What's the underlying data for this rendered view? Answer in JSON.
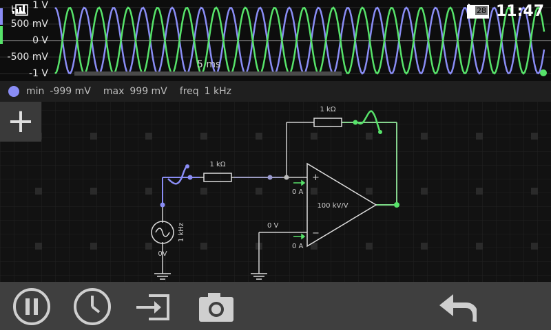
{
  "status_bar": {
    "time": "11:47",
    "battery": "28",
    "carrier": "H"
  },
  "scope": {
    "y_labels": [
      "1 V",
      "500 mV",
      "0 V",
      "-500 mV",
      "-1 V"
    ],
    "timebase": "5 ms",
    "colors": {
      "trace1": "#8a8df5",
      "trace2": "#57e36a"
    }
  },
  "info": {
    "min_label": "min",
    "min_value": "-999 mV",
    "max_label": "max",
    "max_value": "999 mV",
    "freq_label": "freq",
    "freq_value": "1 kHz"
  },
  "circuit": {
    "r_in": "1 kΩ",
    "r_fb": "1 kΩ",
    "source_freq": "1 kHz",
    "source_ground": "0V",
    "opamp_gain": "100 kV/V",
    "inplus_current": "0 A",
    "inminus_current": "0 A",
    "inminus_voltage": "0 V",
    "plus_sign": "+",
    "minus_sign": "−"
  },
  "toolbar": {
    "add_icon": "plus-icon",
    "pause_icon": "pause-icon",
    "clock_icon": "clock-icon",
    "export_icon": "export-icon",
    "camera_icon": "camera-icon",
    "undo_icon": "undo-icon"
  }
}
